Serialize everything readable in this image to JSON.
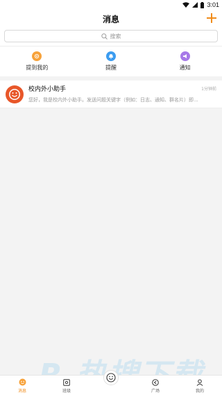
{
  "status_bar": {
    "time": "3:01"
  },
  "header": {
    "title": "消息",
    "add_icon": "plus-icon"
  },
  "search": {
    "placeholder": "搜索",
    "icon": "search-icon"
  },
  "quick_actions": [
    {
      "label": "提到我的",
      "icon": "at-icon",
      "color": "#f7a23b"
    },
    {
      "label": "提醒",
      "icon": "bell-icon",
      "color": "#3c9cf0"
    },
    {
      "label": "通知",
      "icon": "megaphone-icon",
      "color": "#a77ae8"
    }
  ],
  "messages": [
    {
      "name": "校内外小助手",
      "preview": "您好，我是校内外小助手。发送问题关键字（例如：日志、通知、群名片）即...",
      "time": "1分钟前",
      "avatar_color": "#e8572a"
    }
  ],
  "tabbar": [
    {
      "label": "消息",
      "icon": "chat-face-icon",
      "active": true
    },
    {
      "label": "班级",
      "icon": "class-icon",
      "active": false
    },
    {
      "label": "",
      "icon": "smile-center-icon",
      "active": false
    },
    {
      "label": "广场",
      "icon": "square-icon",
      "active": false
    },
    {
      "label": "我的",
      "icon": "user-icon",
      "active": false
    }
  ],
  "colors": {
    "accent": "#f08c1b"
  }
}
